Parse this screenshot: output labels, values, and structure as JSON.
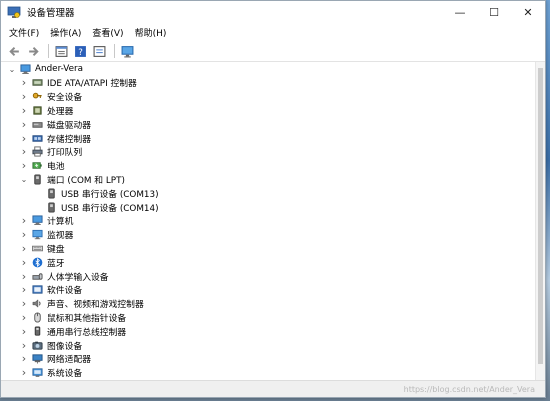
{
  "window": {
    "title": "设备管理器",
    "controls": {
      "minimize": "—",
      "maximize": "☐",
      "close": "✕"
    }
  },
  "menu": [
    "文件(F)",
    "操作(A)",
    "查看(V)",
    "帮助(H)"
  ],
  "toolbar": [
    "back-arrow-icon",
    "forward-arrow-icon",
    "properties-icon",
    "help-icon",
    "view-icon",
    "monitor-icon"
  ],
  "tree": {
    "root": "Ander-Vera",
    "items": [
      {
        "label": "IDE ATA/ATAPI 控制器",
        "icon": "ide-controller-icon",
        "expanded": false
      },
      {
        "label": "安全设备",
        "icon": "security-key-icon",
        "expanded": false
      },
      {
        "label": "处理器",
        "icon": "processor-icon",
        "expanded": false
      },
      {
        "label": "磁盘驱动器",
        "icon": "disk-drive-icon",
        "expanded": false
      },
      {
        "label": "存储控制器",
        "icon": "storage-controller-icon",
        "expanded": false
      },
      {
        "label": "打印队列",
        "icon": "printer-icon",
        "expanded": false
      },
      {
        "label": "电池",
        "icon": "battery-icon",
        "expanded": false
      },
      {
        "label": "端口 (COM 和 LPT)",
        "icon": "port-icon",
        "expanded": true,
        "children": [
          {
            "label": "USB 串行设备 (COM13)",
            "icon": "port-icon"
          },
          {
            "label": "USB 串行设备 (COM14)",
            "icon": "port-icon"
          }
        ]
      },
      {
        "label": "计算机",
        "icon": "computer-icon",
        "expanded": false
      },
      {
        "label": "监视器",
        "icon": "monitor-icon",
        "expanded": false
      },
      {
        "label": "键盘",
        "icon": "keyboard-icon",
        "expanded": false
      },
      {
        "label": "蓝牙",
        "icon": "bluetooth-icon",
        "expanded": false
      },
      {
        "label": "人体学输入设备",
        "icon": "hid-icon",
        "expanded": false
      },
      {
        "label": "软件设备",
        "icon": "software-device-icon",
        "expanded": false
      },
      {
        "label": "声音、视频和游戏控制器",
        "icon": "sound-icon",
        "expanded": false
      },
      {
        "label": "鼠标和其他指针设备",
        "icon": "mouse-icon",
        "expanded": false
      },
      {
        "label": "通用串行总线控制器",
        "icon": "usb-controller-icon",
        "expanded": false
      },
      {
        "label": "图像设备",
        "icon": "camera-icon",
        "expanded": false
      },
      {
        "label": "网络适配器",
        "icon": "network-adapter-icon",
        "expanded": false
      },
      {
        "label": "系统设备",
        "icon": "system-device-icon",
        "expanded": false
      }
    ]
  },
  "watermark": "https://blog.csdn.net/Ander_Vera",
  "colors": {
    "accent": "#2b6cb0",
    "bluetooth": "#1f6fd1",
    "port": "#6b6b6b"
  }
}
